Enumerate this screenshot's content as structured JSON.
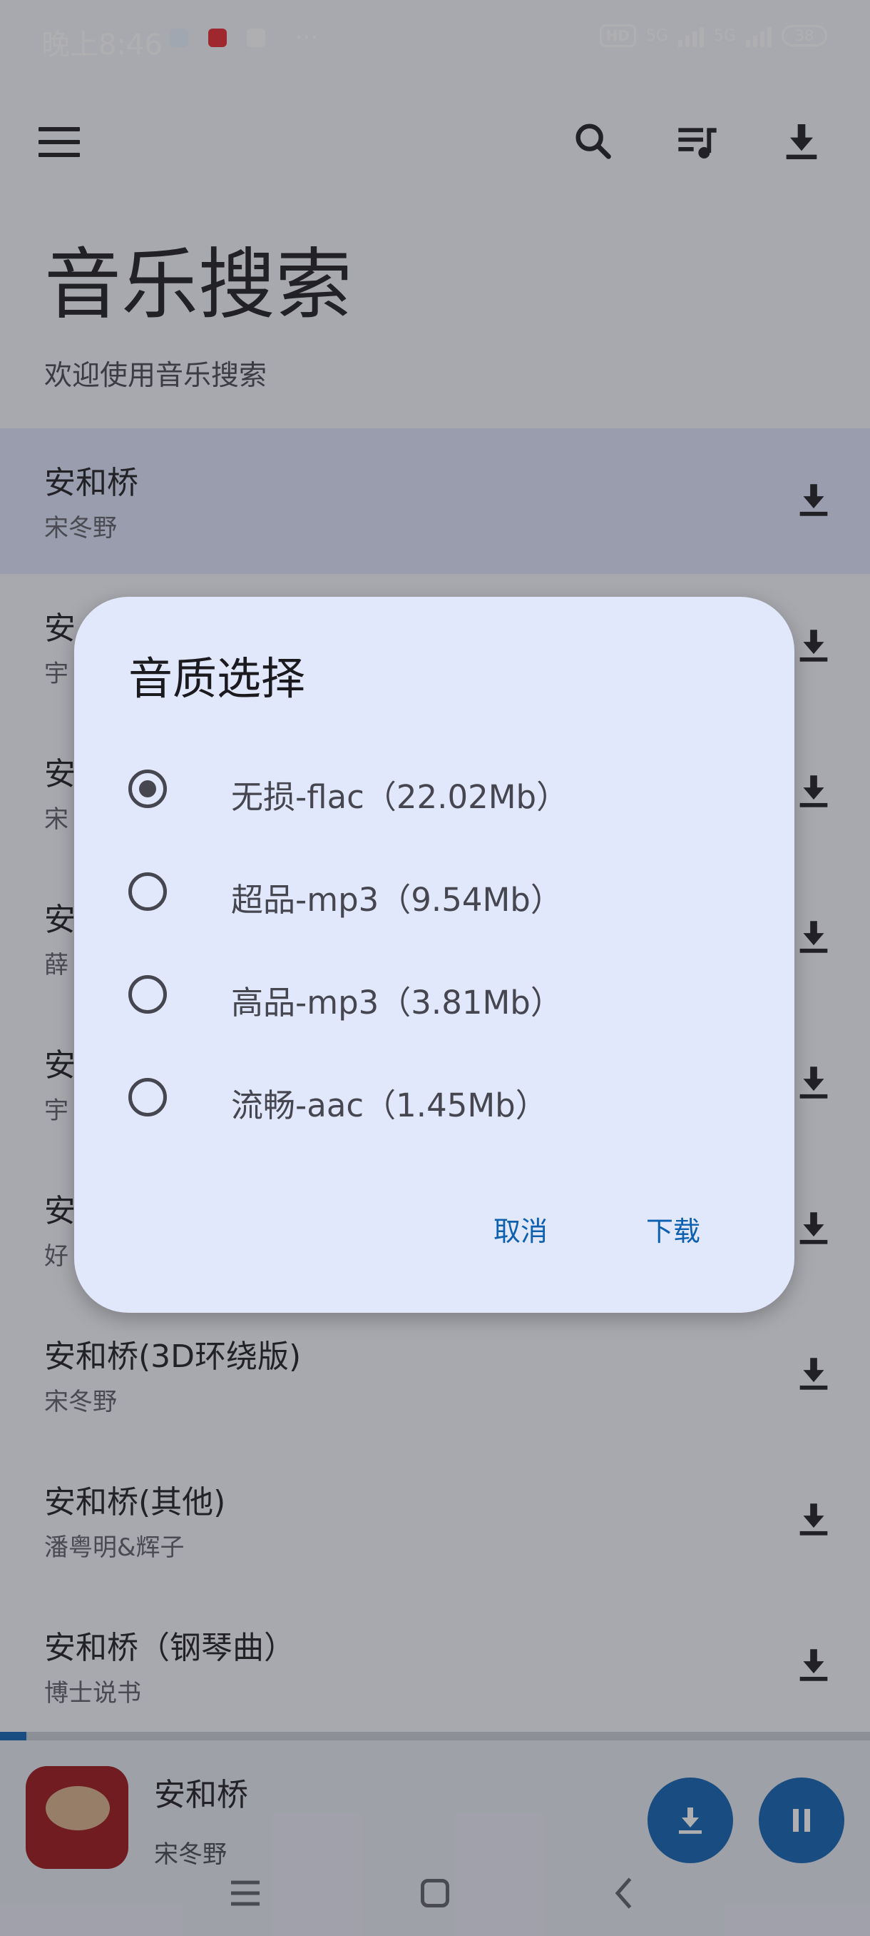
{
  "status_bar": {
    "time": "晚上8:46",
    "more": "···",
    "hd_label": "HD",
    "network_1": "5G",
    "network_2": "5G",
    "battery": "38"
  },
  "app_bar": {
    "title": "音乐搜索",
    "subtitle": "欢迎使用音乐搜索"
  },
  "songs": [
    {
      "title": "安和桥",
      "artist": "宋冬野",
      "selected": true
    },
    {
      "title": "安",
      "artist": "宇"
    },
    {
      "title": "安",
      "artist": "宋"
    },
    {
      "title": "安",
      "artist": "薛"
    },
    {
      "title": "安",
      "artist": "宇"
    },
    {
      "title": "安",
      "artist": "好"
    },
    {
      "title": "安和桥(3D环绕版)",
      "artist": "宋冬野"
    },
    {
      "title": "安和桥(其他)",
      "artist": "潘粤明&辉子"
    },
    {
      "title": "安和桥（钢琴曲）",
      "artist": "博士说书"
    }
  ],
  "player": {
    "title": "安和桥",
    "artist": "宋冬野",
    "progress": 0.03
  },
  "dialog": {
    "title": "音质选择",
    "options": [
      {
        "label": "无损-flac（22.02Mb）",
        "selected": true
      },
      {
        "label": "超品-mp3（9.54Mb）",
        "selected": false
      },
      {
        "label": "高品-mp3（3.81Mb）",
        "selected": false
      },
      {
        "label": "流畅-aac（1.45Mb）",
        "selected": false
      }
    ],
    "cancel_label": "取消",
    "confirm_label": "下载"
  },
  "icons": {
    "menu": "menu-icon",
    "search": "search-icon",
    "playlist": "queue-music-icon",
    "download": "download-icon",
    "pause": "pause-icon"
  },
  "colors": {
    "primary": "#0d5fb0",
    "dialog_bg": "#e2e8fb",
    "selected_row": "#dbe2f9"
  }
}
